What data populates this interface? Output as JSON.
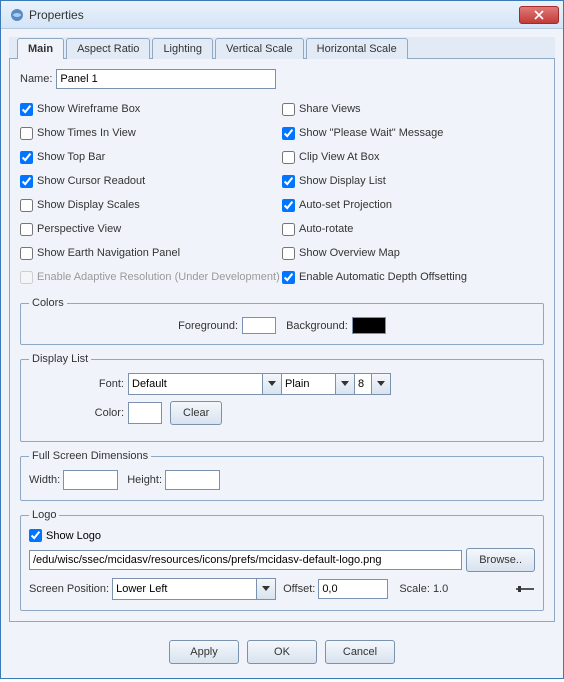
{
  "window": {
    "title": "Properties"
  },
  "tabs": [
    "Main",
    "Aspect Ratio",
    "Lighting",
    "Vertical Scale",
    "Horizontal Scale"
  ],
  "name": {
    "label": "Name:",
    "value": "Panel 1"
  },
  "left_checks": [
    {
      "label": "Show Wireframe Box",
      "checked": true,
      "enabled": true
    },
    {
      "label": "Show Times In View",
      "checked": false,
      "enabled": true
    },
    {
      "label": "Show Top Bar",
      "checked": true,
      "enabled": true
    },
    {
      "label": "Show Cursor Readout",
      "checked": true,
      "enabled": true
    },
    {
      "label": "Show Display Scales",
      "checked": false,
      "enabled": true
    },
    {
      "label": "Perspective View",
      "checked": false,
      "enabled": true
    },
    {
      "label": "Show Earth Navigation Panel",
      "checked": false,
      "enabled": true
    },
    {
      "label": "Enable Adaptive Resolution (Under Development)",
      "checked": false,
      "enabled": false
    }
  ],
  "right_checks": [
    {
      "label": "Share Views",
      "checked": false,
      "enabled": true
    },
    {
      "label": "Show \"Please Wait\" Message",
      "checked": true,
      "enabled": true
    },
    {
      "label": "Clip View At Box",
      "checked": false,
      "enabled": true
    },
    {
      "label": "Show Display List",
      "checked": true,
      "enabled": true
    },
    {
      "label": "Auto-set Projection",
      "checked": true,
      "enabled": true
    },
    {
      "label": "Auto-rotate",
      "checked": false,
      "enabled": true
    },
    {
      "label": "Show Overview Map",
      "checked": false,
      "enabled": true
    },
    {
      "label": "Enable Automatic Depth Offsetting",
      "checked": true,
      "enabled": true
    }
  ],
  "colors": {
    "legend": "Colors",
    "fg_label": "Foreground:",
    "fg_value": "#ffffff",
    "bg_label": "Background:",
    "bg_value": "#000000"
  },
  "display_list": {
    "legend": "Display List",
    "font_label": "Font:",
    "font_family": "Default",
    "font_style": "Plain",
    "font_size": "8",
    "color_label": "Color:",
    "color_value": "#ffffff",
    "clear_label": "Clear"
  },
  "fsd": {
    "legend": "Full Screen Dimensions",
    "width_label": "Width:",
    "width_value": "",
    "height_label": "Height:",
    "height_value": ""
  },
  "logo": {
    "legend": "Logo",
    "show_label": "Show Logo",
    "show_checked": true,
    "path": "/edu/wisc/ssec/mcidasv/resources/icons/prefs/mcidasv-default-logo.png",
    "browse_label": "Browse..",
    "pos_label": "Screen Position:",
    "pos_value": "Lower Left",
    "offset_label": "Offset:",
    "offset_value": "0,0",
    "scale_label": "Scale: 1.0"
  },
  "buttons": {
    "apply": "Apply",
    "ok": "OK",
    "cancel": "Cancel"
  }
}
